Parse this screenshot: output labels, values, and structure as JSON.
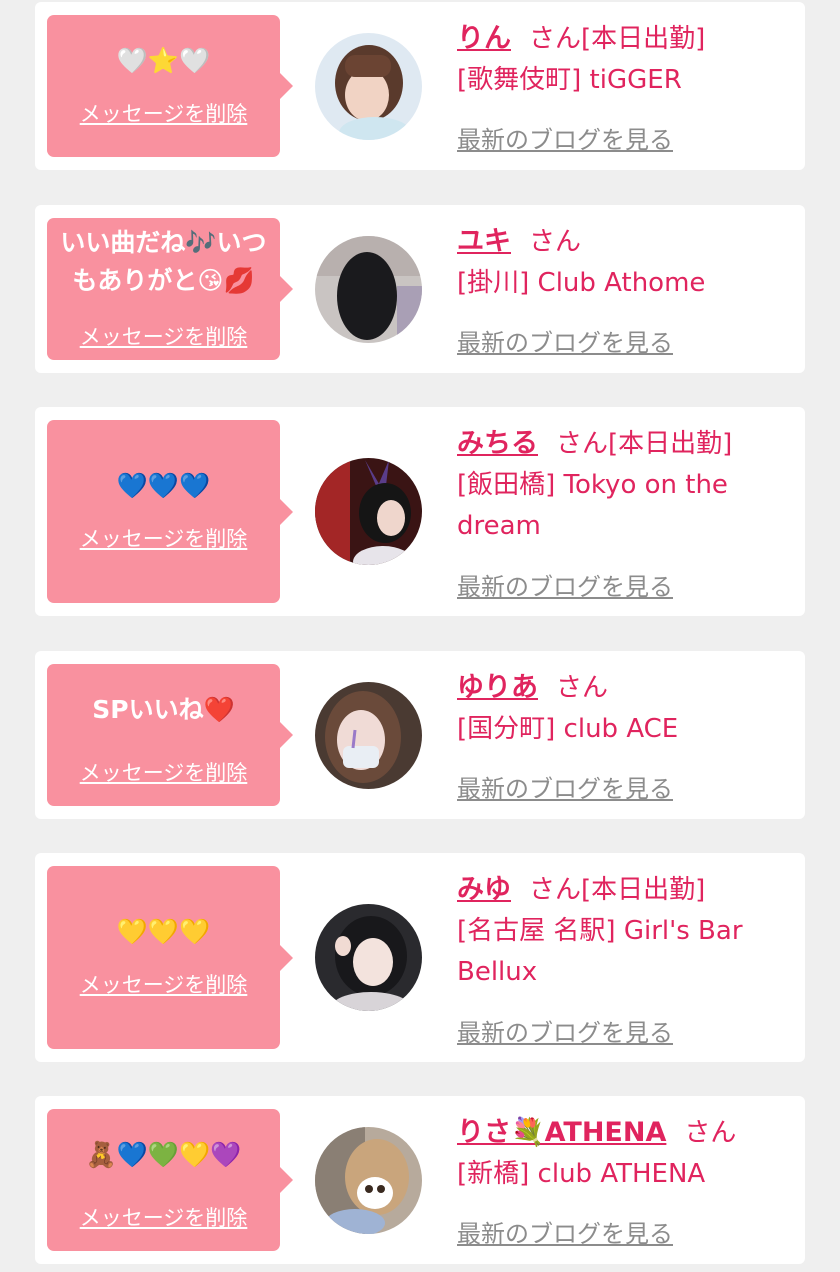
{
  "common": {
    "delete_label": "メッセージを削除",
    "blog_label": "最新のブログを見る",
    "colors": {
      "background": "#efefef",
      "card": "#ffffff",
      "bubble": "#f9919f",
      "accent_text": "#e0245e",
      "link_gray": "#8c8c8c"
    }
  },
  "messages": [
    {
      "bubble_text": "🤍⭐🤍",
      "cast_name": "りん",
      "suffix": "さん[本日出勤]",
      "shop": "[歌舞伎町] tiGGER",
      "avatar_icon": "cast-photo"
    },
    {
      "bubble_text": "いい曲だね🎶いつもありがと😘💋",
      "cast_name": "ユキ",
      "suffix": "さん",
      "shop": "[掛川] Club Athome",
      "avatar_icon": "cast-photo"
    },
    {
      "bubble_text": "💙💙💙",
      "cast_name": "みちる",
      "suffix": "さん[本日出勤]",
      "shop": "[飯田橋] Tokyo on the dream",
      "avatar_icon": "cast-photo"
    },
    {
      "bubble_text": "SPいいね❤️",
      "cast_name": "ゆりあ",
      "suffix": "さん",
      "shop": "[国分町] club ACE",
      "avatar_icon": "cast-photo"
    },
    {
      "bubble_text": "💛💛💛",
      "cast_name": "みゆ",
      "suffix": "さん[本日出勤]",
      "shop": "[名古屋 名駅] Girl's Bar Bellux",
      "avatar_icon": "cast-photo"
    },
    {
      "bubble_text": "🧸💙💚💛💜",
      "cast_name": "りさ💐ATHENA",
      "suffix": "さん",
      "shop": "[新橋] club ATHENA",
      "avatar_icon": "cast-photo"
    }
  ]
}
